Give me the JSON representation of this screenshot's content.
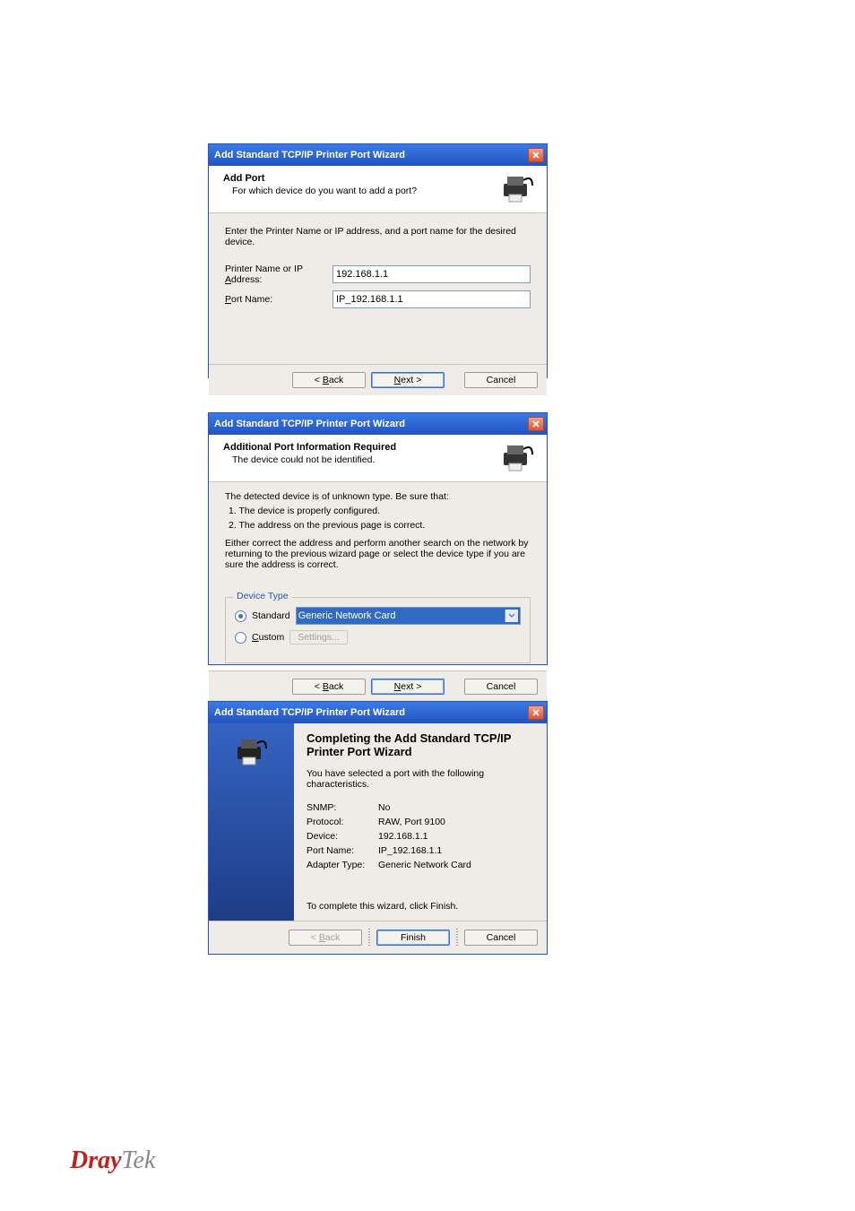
{
  "wizard_title": "Add Standard TCP/IP Printer Port Wizard",
  "dialog1": {
    "header_title": "Add Port",
    "header_sub": "For which device do you want to add a port?",
    "instruction": "Enter the Printer Name or IP address, and a port name for the desired device.",
    "label_printer": "Printer Name or IP Address:",
    "label_port": "Port Name:",
    "value_printer": "192.168.1.1",
    "value_port": "IP_192.168.1.1",
    "btn_back": "< Back",
    "btn_next": "Next >",
    "btn_cancel": "Cancel"
  },
  "dialog2": {
    "header_title": "Additional Port Information Required",
    "header_sub": "The device could not be identified.",
    "line1": "The detected device is of unknown type.  Be sure that:",
    "line2": "1.  The device is properly configured.",
    "line3": "2.  The address on the previous page is correct.",
    "line4": "Either correct the address and perform another search on the network by returning to the previous wizard page or select the device type if you are sure the address is correct.",
    "group_label": "Device Type",
    "radio_std": "Standard",
    "dropdown_value": "Generic Network Card",
    "radio_custom": "Custom",
    "settings_btn": "Settings...",
    "btn_back": "< Back",
    "btn_next": "Next >",
    "btn_cancel": "Cancel"
  },
  "dialog3": {
    "title": "Completing the Add Standard TCP/IP Printer Port Wizard",
    "subtitle": "You have selected a port with the following characteristics.",
    "rows": {
      "snmp_k": "SNMP:",
      "snmp_v": "No",
      "proto_k": "Protocol:",
      "proto_v": "RAW, Port 9100",
      "dev_k": "Device:",
      "dev_v": "192.168.1.1",
      "port_k": "Port Name:",
      "port_v": "IP_192.168.1.1",
      "adapt_k": "Adapter Type:",
      "adapt_v": "Generic Network Card"
    },
    "complete": "To complete this wizard, click Finish.",
    "btn_back": "< Back",
    "btn_finish": "Finish",
    "btn_cancel": "Cancel"
  },
  "footer": {
    "dray": "Dray",
    "tek": "Tek"
  }
}
